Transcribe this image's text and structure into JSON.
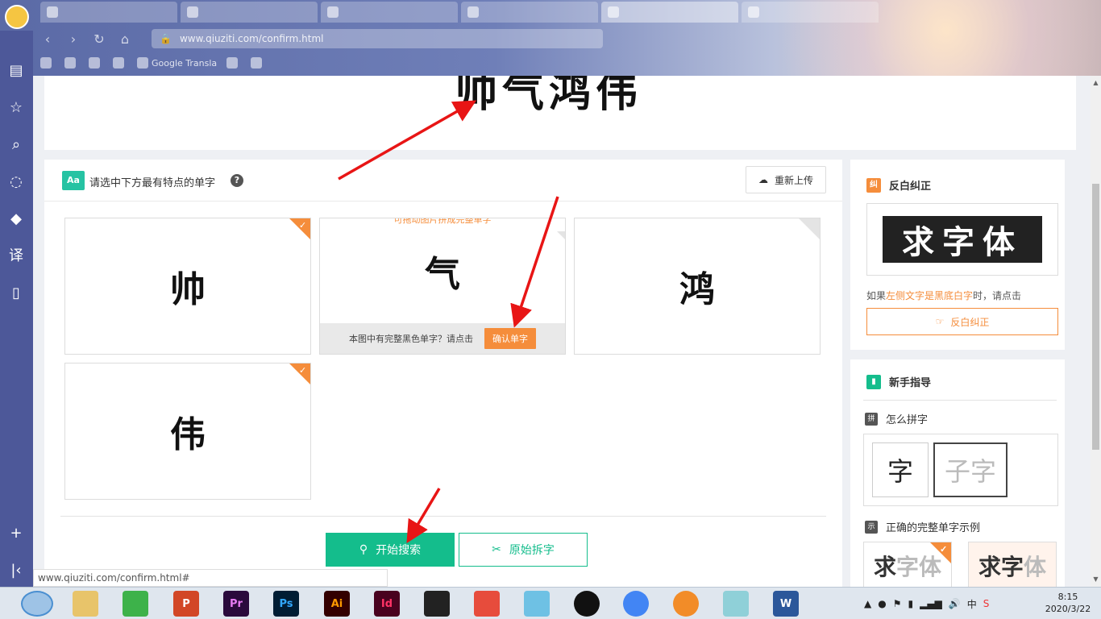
{
  "browser": {
    "tabs": [
      "",
      "",
      "",
      "",
      "",
      ""
    ],
    "address_url": "www.qiuziti.com/confirm.html",
    "bookmarks": [
      "",
      "",
      "",
      "",
      "Google Transla",
      "",
      "",
      "",
      "",
      ""
    ],
    "status_url": "www.qiuziti.com/confirm.html#"
  },
  "preview": {
    "text": "帅气鸿伟"
  },
  "main": {
    "header_text": "请选中下方最有特点的单字",
    "help_label": "?",
    "aa_label": "Aa",
    "reupload_label": "重新上传",
    "cards": [
      {
        "glyph": "帅",
        "selected": true
      },
      {
        "glyph": "气",
        "selected": false,
        "hint": "可拖动图片拼成完整单字",
        "footer_text": "本图中有完整黑色单字？请点击",
        "confirm_label": "确认单字"
      },
      {
        "glyph": "鸿",
        "selected": false
      },
      {
        "glyph": "伟",
        "selected": true
      }
    ],
    "search_label": "开始搜索",
    "original_label": "原始拆字"
  },
  "invert_panel": {
    "title": "反白纠正",
    "sample_text": "求字体",
    "note_prefix": "如果",
    "note_hl1": "左侧文字是",
    "note_hl2": "黑底白字",
    "note_suffix": "时，请点击",
    "button_label": "反白纠正"
  },
  "guide_panel": {
    "title": "新手指导",
    "how_to": "怎么拼字",
    "demo_char": "字",
    "demo_faded": "子字",
    "example_title": "正确的完整单字示例",
    "example_left_dark": "求",
    "example_left_light": "字体",
    "example_right_dark": "求字",
    "example_right_light": "体"
  },
  "taskbar": {
    "apps": [
      "",
      "",
      "P",
      "Pr",
      "Ps",
      "Ai",
      "Id",
      "",
      "",
      "",
      "",
      "",
      "",
      "",
      "W"
    ],
    "ime": "中",
    "time": "8:15",
    "date": "2020/3/22"
  },
  "colors": {
    "accent_green": "#14bd8c",
    "accent_orange": "#f58d3b",
    "sidebar": "#4d5899"
  }
}
